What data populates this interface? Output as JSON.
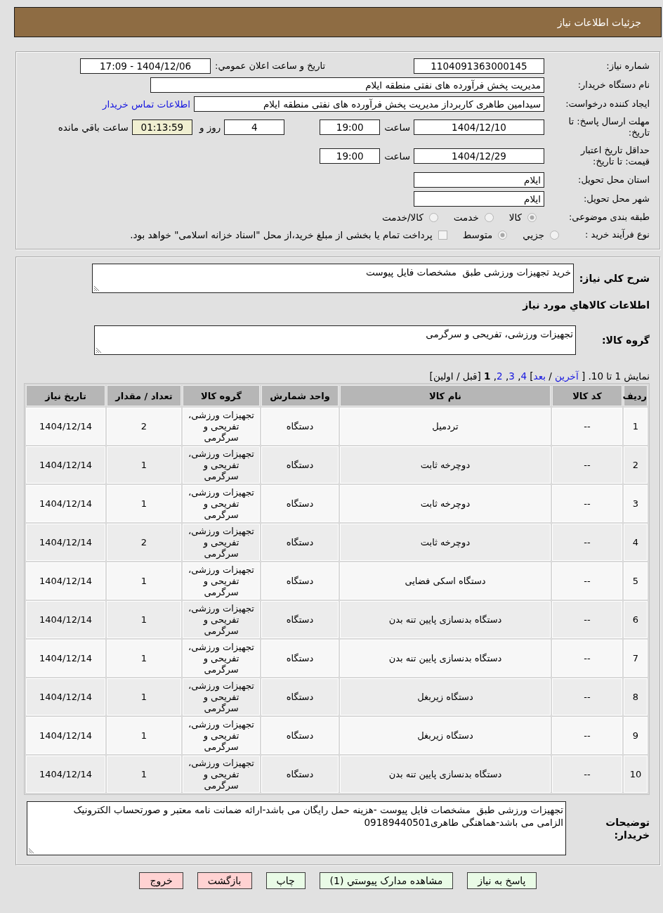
{
  "header": {
    "title": "جزئیات اطلاعات نیاز"
  },
  "details": {
    "need_number": {
      "label": "شماره نیاز:",
      "value": "1104091363000145"
    },
    "announcement": {
      "label": "تاریخ و ساعت اعلان عمومي:",
      "value": "1404/12/06 - 17:09"
    },
    "buyer_organization": {
      "label": "نام دستگاه خريدار:",
      "value": "مدیریت پخش فرآورده های نفتی منطقه ایلام"
    },
    "requester": {
      "label": "ایجاد کننده درخواست:",
      "value": "سیدامین طاهری کاربرداز مدیریت پخش فرآورده های نفتی منطقه ایلام",
      "contact_link": "اطلاعات تماس خريدار"
    },
    "response_deadline": {
      "label": "مهلت ارسال پاسخ: تا تاریخ:",
      "date": "1404/12/10",
      "time_label": "ساعت",
      "time": "19:00",
      "days": "4",
      "days_label": "روز و",
      "remaining": "01:13:59",
      "remaining_label": "ساعت باقي مانده"
    },
    "price_validity": {
      "label": "حداقل تاریخ اعتبار قیمت: تا تاریخ:",
      "date": "1404/12/29",
      "time_label": "ساعت",
      "time": "19:00"
    },
    "delivery_province": {
      "label": "استان محل تحویل:",
      "value": "ایلام"
    },
    "delivery_city": {
      "label": "شهر محل تحویل:",
      "value": "ایلام"
    },
    "category": {
      "label": "طبقه بندی موضوعی:",
      "options": [
        {
          "label": "کالا",
          "selected": true
        },
        {
          "label": "خدمت",
          "selected": false
        },
        {
          "label": "کالا/خدمت",
          "selected": false
        }
      ]
    },
    "purchase_type": {
      "label": "نوع فرآیند خرید :",
      "options": [
        {
          "label": "جزيي",
          "selected": false
        },
        {
          "label": "متوسط",
          "selected": true
        }
      ],
      "treasury": {
        "label": "پرداخت تمام یا بخشی از مبلغ خرید،از محل \"اسناد خزانه اسلامی\" خواهد بود.",
        "checked": false
      }
    }
  },
  "summary": {
    "label": "شرح کلي نیاز:",
    "value": "خرید تجهیزات ورزشی طبق  مشخصات فایل پیوست"
  },
  "goods_heading": "اطلاعات کالاهاي مورد نیاز",
  "goods_group": {
    "label": "گروه کالا:",
    "value": "تجهیزات ورزشی، تفریحی و سرگرمی"
  },
  "pagination": {
    "segments": [
      {
        "kind": "text",
        "text": "نمایش 1 تا 10. [ "
      },
      {
        "kind": "nav",
        "text": "آخرین"
      },
      {
        "kind": "text",
        "text": " / "
      },
      {
        "kind": "nav",
        "text": "بعد"
      },
      {
        "kind": "text",
        "text": "] "
      },
      {
        "kind": "page",
        "text": "4",
        "selected": false
      },
      {
        "kind": "text",
        "text": ", "
      },
      {
        "kind": "page",
        "text": "3",
        "selected": false
      },
      {
        "kind": "text",
        "text": ", "
      },
      {
        "kind": "page",
        "text": "2",
        "selected": false
      },
      {
        "kind": "text",
        "text": ", "
      },
      {
        "kind": "page",
        "text": "1",
        "selected": true
      },
      {
        "kind": "text",
        "text": " [قبل / اولین]"
      }
    ]
  },
  "table": {
    "columns": [
      "ردیف",
      "کد کالا",
      "نام کالا",
      "واحد شمارش",
      "گروه کالا",
      "تعداد / مقدار",
      "تاریخ نیاز"
    ],
    "rows": [
      [
        "1",
        "--",
        "تردمیل",
        "دستگاه",
        "تجهیزات ورزشی، تفریحی و سرگرمی",
        "2",
        "1404/12/14"
      ],
      [
        "2",
        "--",
        "دوچرخه ثابت",
        "دستگاه",
        "تجهیزات ورزشی، تفریحی و سرگرمی",
        "1",
        "1404/12/14"
      ],
      [
        "3",
        "--",
        "دوچرخه ثابت",
        "دستگاه",
        "تجهیزات ورزشی، تفریحی و سرگرمی",
        "1",
        "1404/12/14"
      ],
      [
        "4",
        "--",
        "دوچرخه ثابت",
        "دستگاه",
        "تجهیزات ورزشی، تفریحی و سرگرمی",
        "2",
        "1404/12/14"
      ],
      [
        "5",
        "--",
        "دستگاه اسکی فضایی",
        "دستگاه",
        "تجهیزات ورزشی، تفریحی و سرگرمی",
        "1",
        "1404/12/14"
      ],
      [
        "6",
        "--",
        "دستگاه بدنسازی پایین تنه بدن",
        "دستگاه",
        "تجهیزات ورزشی، تفریحی و سرگرمی",
        "1",
        "1404/12/14"
      ],
      [
        "7",
        "--",
        "دستگاه بدنسازی پایین تنه بدن",
        "دستگاه",
        "تجهیزات ورزشی، تفریحی و سرگرمی",
        "1",
        "1404/12/14"
      ],
      [
        "8",
        "--",
        "دستگاه زیربغل",
        "دستگاه",
        "تجهیزات ورزشی، تفریحی و سرگرمی",
        "1",
        "1404/12/14"
      ],
      [
        "9",
        "--",
        "دستگاه زیربغل",
        "دستگاه",
        "تجهیزات ورزشی، تفریحی و سرگرمی",
        "1",
        "1404/12/14"
      ],
      [
        "10",
        "--",
        "دستگاه بدنسازی پایین تنه بدن",
        "دستگاه",
        "تجهیزات ورزشی، تفریحی و سرگرمی",
        "1",
        "1404/12/14"
      ]
    ]
  },
  "notes": {
    "label": "توضیحات خریدار:",
    "value": "تجهیزات ورزشی طبق  مشخصات فایل پیوست -هزینه حمل رایگان می باشد-ارائه ضمانت نامه معتبر و صورتحساب الکترونیک الزامی می باشد-هماهنگی طاهری09189440501"
  },
  "buttons": [
    {
      "label": "پاسخ به نیاز",
      "kind": "action"
    },
    {
      "label": "مشاهده مدارک پیوستي (1)",
      "kind": "action"
    },
    {
      "label": "چاپ",
      "kind": "action"
    },
    {
      "label": "بازگشت",
      "kind": "exit"
    },
    {
      "label": "خروج",
      "kind": "exit"
    }
  ]
}
